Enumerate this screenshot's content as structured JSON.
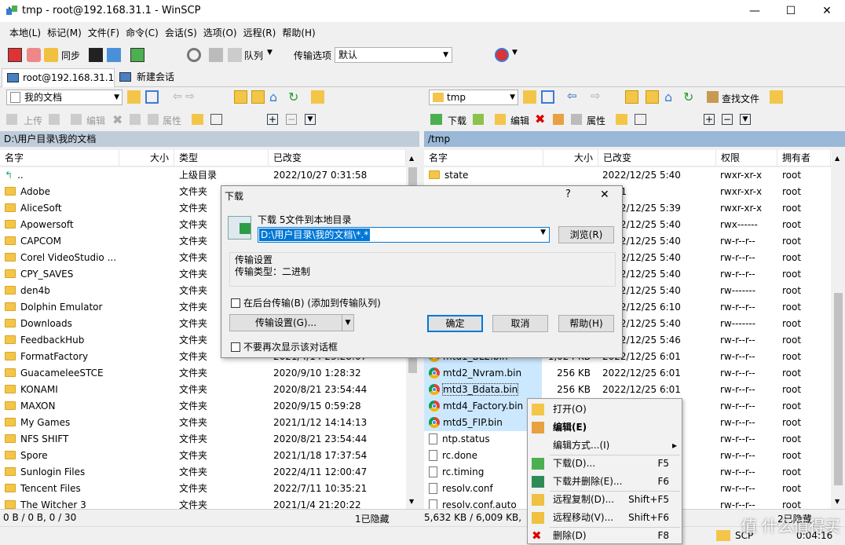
{
  "window": {
    "title": "tmp - root@192.168.31.1 - WinSCP"
  },
  "menu": [
    "本地(L)",
    "标记(M)",
    "文件(F)",
    "命令(C)",
    "会话(S)",
    "选项(O)",
    "远程(R)",
    "帮助(H)"
  ],
  "toolbar": {
    "sync_label": "同步",
    "queue_label": "队列",
    "transfer_options_label": "传输选项",
    "transfer_options_value": "默认"
  },
  "tabs": {
    "session": "root@192.168.31.1",
    "new_session": "新建会话"
  },
  "left": {
    "location": "我的文档",
    "upload_label": "上传",
    "edit_label": "编辑",
    "props_label": "属性",
    "path": "D:\\用户目录\\我的文档",
    "headers": {
      "name": "名字",
      "size": "大小",
      "type": "类型",
      "modified": "已改变"
    },
    "rows": [
      {
        "name": "..",
        "type": "上级目录",
        "modified": "2022/10/27   0:31:58",
        "icon": "parent"
      },
      {
        "name": "Adobe",
        "type": "文件夹",
        "modified": "",
        "icon": "folder"
      },
      {
        "name": "AliceSoft",
        "type": "文件夹",
        "modified": "",
        "icon": "folder"
      },
      {
        "name": "Apowersoft",
        "type": "文件夹",
        "modified": "",
        "icon": "folder"
      },
      {
        "name": "CAPCOM",
        "type": "文件夹",
        "modified": "",
        "icon": "folder"
      },
      {
        "name": "Corel VideoStudio ...",
        "type": "文件夹",
        "modified": "",
        "icon": "folder"
      },
      {
        "name": "CPY_SAVES",
        "type": "文件夹",
        "modified": "",
        "icon": "folder"
      },
      {
        "name": "den4b",
        "type": "文件夹",
        "modified": "",
        "icon": "folder"
      },
      {
        "name": "Dolphin Emulator",
        "type": "文件夹",
        "modified": "",
        "icon": "folder"
      },
      {
        "name": "Downloads",
        "type": "文件夹",
        "modified": "",
        "icon": "folder"
      },
      {
        "name": "FeedbackHub",
        "type": "文件夹",
        "modified": "",
        "icon": "folder"
      },
      {
        "name": "FormatFactory",
        "type": "文件夹",
        "modified": "2021/4/14   23:28:07",
        "icon": "folder"
      },
      {
        "name": "GuacameleeSTCE",
        "type": "文件夹",
        "modified": "2020/9/10   1:28:32",
        "icon": "folder"
      },
      {
        "name": "KONAMI",
        "type": "文件夹",
        "modified": "2020/8/21   23:54:44",
        "icon": "folder"
      },
      {
        "name": "MAXON",
        "type": "文件夹",
        "modified": "2020/9/15   0:59:28",
        "icon": "folder"
      },
      {
        "name": "My Games",
        "type": "文件夹",
        "modified": "2021/1/12   14:14:13",
        "icon": "folder"
      },
      {
        "name": "NFS SHIFT",
        "type": "文件夹",
        "modified": "2020/8/21   23:54:44",
        "icon": "folder"
      },
      {
        "name": "Spore",
        "type": "文件夹",
        "modified": "2021/1/18   17:37:54",
        "icon": "folder"
      },
      {
        "name": "Sunlogin Files",
        "type": "文件夹",
        "modified": "2022/4/11   12:00:47",
        "icon": "folder"
      },
      {
        "name": "Tencent Files",
        "type": "文件夹",
        "modified": "2022/7/11   10:35:21",
        "icon": "folder"
      },
      {
        "name": "The Witcher 3",
        "type": "文件夹",
        "modified": "2021/1/4   21:20:22",
        "icon": "folder"
      }
    ]
  },
  "right": {
    "location": "tmp",
    "download_label": "下载",
    "edit_label": "编辑",
    "props_label": "属性",
    "find_label": "查找文件",
    "path": "/tmp",
    "headers": {
      "name": "名字",
      "size": "大小",
      "modified": "已改变",
      "perms": "权限",
      "owner": "拥有者"
    },
    "rows": [
      {
        "name": "state",
        "size": "",
        "modified": "2022/12/25 5:40",
        "perms": "rwxr-xr-x",
        "owner": "root",
        "icon": "folder",
        "sel": false
      },
      {
        "name": "",
        "size": "",
        "modified": "1/1/1",
        "perms": "rwxr-xr-x",
        "owner": "root",
        "icon": "",
        "sel": false
      },
      {
        "name": "",
        "size": "",
        "modified": "2022/12/25 5:39",
        "perms": "rwxr-xr-x",
        "owner": "root",
        "icon": "",
        "sel": false
      },
      {
        "name": "",
        "size": "",
        "modified": "2022/12/25 5:40",
        "perms": "rwx------",
        "owner": "root",
        "icon": "",
        "sel": false
      },
      {
        "name": "",
        "size": "",
        "modified": "2022/12/25 5:40",
        "perms": "rw-r--r--",
        "owner": "root",
        "icon": "",
        "sel": false
      },
      {
        "name": "",
        "size": "",
        "modified": "2022/12/25 5:40",
        "perms": "rw-r--r--",
        "owner": "root",
        "icon": "",
        "sel": false
      },
      {
        "name": "",
        "size": "",
        "modified": "2022/12/25 5:40",
        "perms": "rw-r--r--",
        "owner": "root",
        "icon": "",
        "sel": false
      },
      {
        "name": "",
        "size": "",
        "modified": "2022/12/25 5:40",
        "perms": "rw-------",
        "owner": "root",
        "icon": "",
        "sel": false
      },
      {
        "name": "",
        "size": "",
        "modified": "2022/12/25 6:10",
        "perms": "rw-r--r--",
        "owner": "root",
        "icon": "",
        "sel": false
      },
      {
        "name": "",
        "size": "",
        "modified": "2022/12/25 5:40",
        "perms": "rw-------",
        "owner": "root",
        "icon": "",
        "sel": false
      },
      {
        "name": "",
        "size": "",
        "modified": "2022/12/25 5:46",
        "perms": "rw-r--r--",
        "owner": "root",
        "icon": "",
        "sel": false
      },
      {
        "name": "mtd1_BL2.bin",
        "size": "1,024 KB",
        "modified": "2022/12/25 6:01",
        "perms": "rw-r--r--",
        "owner": "root",
        "icon": "chrome",
        "sel": true
      },
      {
        "name": "mtd2_Nvram.bin",
        "size": "256 KB",
        "modified": "2022/12/25 6:01",
        "perms": "rw-r--r--",
        "owner": "root",
        "icon": "chrome",
        "sel": true
      },
      {
        "name": "mtd3_Bdata.bin",
        "size": "256 KB",
        "modified": "2022/12/25 6:01",
        "perms": "rw-r--r--",
        "owner": "root",
        "icon": "chrome",
        "sel": true
      },
      {
        "name": "mtd4_Factory.bin",
        "size": "",
        "modified": "",
        "perms": "rw-r--r--",
        "owner": "root",
        "icon": "chrome",
        "sel": true
      },
      {
        "name": "mtd5_FIP.bin",
        "size": "",
        "modified": "",
        "perms": "rw-r--r--",
        "owner": "root",
        "icon": "chrome",
        "sel": true
      },
      {
        "name": "ntp.status",
        "size": "",
        "modified": "",
        "perms": "rw-r--r--",
        "owner": "root",
        "icon": "file",
        "sel": false
      },
      {
        "name": "rc.done",
        "size": "",
        "modified": "",
        "perms": "rw-r--r--",
        "owner": "root",
        "icon": "file",
        "sel": false
      },
      {
        "name": "rc.timing",
        "size": "",
        "modified": "",
        "perms": "rw-r--r--",
        "owner": "root",
        "icon": "file",
        "sel": false
      },
      {
        "name": "resolv.conf",
        "size": "",
        "modified": "",
        "perms": "rw-r--r--",
        "owner": "root",
        "icon": "file",
        "sel": false
      },
      {
        "name": "resolv.conf.auto",
        "size": "",
        "modified": "",
        "perms": "rw-r--r--",
        "owner": "root",
        "icon": "file",
        "sel": false
      }
    ]
  },
  "status": {
    "left": "0 B / 0 B,   0 / 30",
    "left_hidden": "1已隐藏",
    "right": "5,632 KB / 6,009 KB,",
    "right_hidden": "2已隐藏",
    "protocol": "SCP",
    "time": "0:04:16"
  },
  "dialog": {
    "title": "下载",
    "help_glyph": "?",
    "heading": "下载 5文件到本地目录",
    "path_value": "D:\\用户目录\\我的文档\\*.*",
    "browse_label": "浏览(R)",
    "group_title": "传输设置",
    "transfer_type": "传输类型：二进制",
    "background_label": "在后台传输(B) (添加到传输队列)",
    "transfer_settings_label": "传输设置(G)...",
    "ok_label": "确定",
    "cancel_label": "取消",
    "help_label": "帮助(H)",
    "dont_show_label": "不要再次显示该对话框"
  },
  "context_menu": {
    "items": [
      {
        "label": "打开(O)",
        "shortcut": "",
        "icon": "open-folder-icon"
      },
      {
        "label": "编辑(E)",
        "shortcut": "",
        "icon": "edit-icon",
        "bold": true
      },
      {
        "label": "编辑方式...(I)",
        "shortcut": "",
        "icon": "",
        "submenu": true
      },
      {
        "label": "下载(D)...",
        "shortcut": "F5",
        "icon": "download-icon"
      },
      {
        "label": "下载并删除(E)...",
        "shortcut": "F6",
        "icon": "download-delete-icon"
      },
      {
        "label": "远程复制(D)...",
        "shortcut": "Shift+F5",
        "icon": "remote-copy-icon"
      },
      {
        "label": "远程移动(V)...",
        "shortcut": "Shift+F6",
        "icon": "remote-move-icon"
      },
      {
        "label": "删除(D)",
        "shortcut": "F8",
        "icon": "delete-icon"
      }
    ]
  },
  "watermark": "值 什么值得买",
  "colors": {
    "selection": "#cce8ff",
    "pathbar_active": "#9ab8d7",
    "pathbar_inactive": "#bfcddb",
    "accent": "#0078d7"
  }
}
